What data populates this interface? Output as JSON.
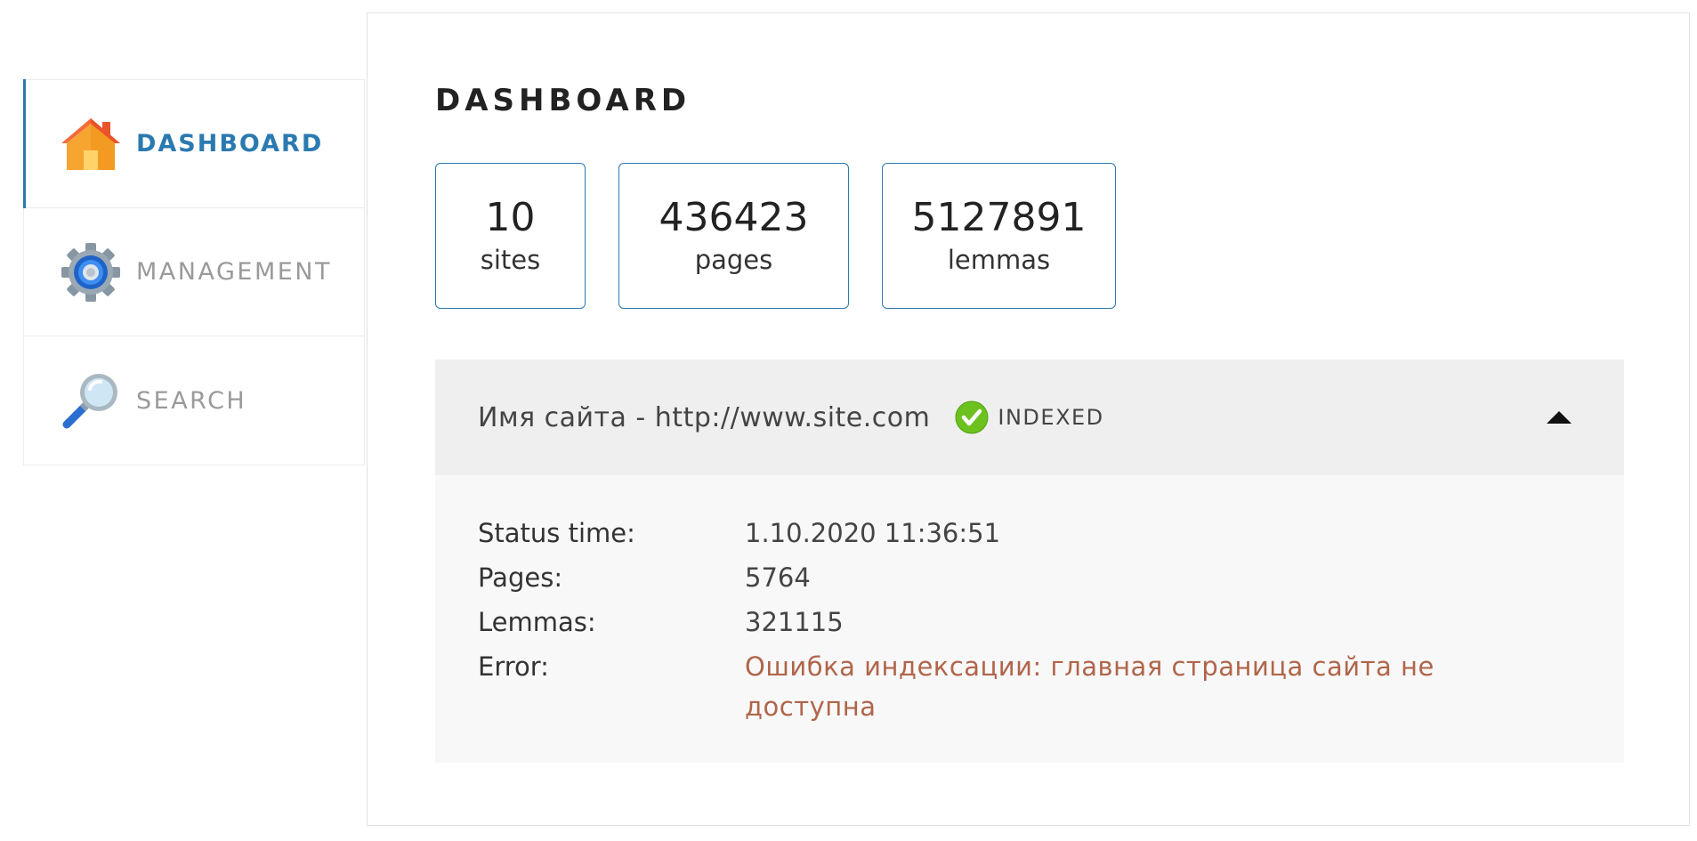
{
  "sidebar": {
    "items": [
      {
        "label": "DASHBOARD",
        "icon": "home-icon",
        "active": true
      },
      {
        "label": "MANAGEMENT",
        "icon": "gear-icon",
        "active": false
      },
      {
        "label": "SEARCH",
        "icon": "magnifier-icon",
        "active": false
      }
    ]
  },
  "main": {
    "title": "DASHBOARD",
    "stats": [
      {
        "value": "10",
        "label": "sites"
      },
      {
        "value": "436423",
        "label": "pages"
      },
      {
        "value": "5127891",
        "label": "lemmas"
      }
    ],
    "site": {
      "name": "Имя сайта - http://www.site.com",
      "status": "INDEXED",
      "status_color": "#6cc11f",
      "details": [
        {
          "key": "Status time:",
          "value": "1.10.2020 11:36:51"
        },
        {
          "key": "Pages:",
          "value": "5764"
        },
        {
          "key": "Lemmas:",
          "value": "321115"
        },
        {
          "key": "Error:",
          "value": "Ошибка индексации: главная страница сайта не доступна"
        }
      ]
    }
  },
  "colors": {
    "accent": "#2a7ab0",
    "error": "#b0654a",
    "header_bg": "#efefef",
    "details_bg": "#f8f8f8"
  }
}
